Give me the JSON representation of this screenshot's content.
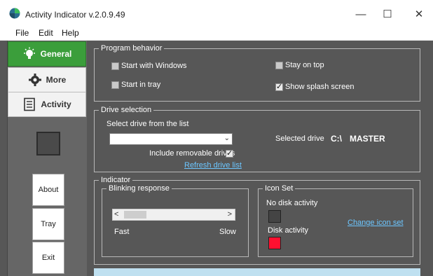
{
  "window": {
    "title": "Activity Indicator v.2.0.9.49",
    "controls": {
      "minimize": "—",
      "maximize": "☐",
      "close": "✕"
    }
  },
  "menu": [
    "File",
    "Edit",
    "Help"
  ],
  "sidebar": {
    "nav": [
      {
        "label": "General",
        "icon": "lightbulb-icon",
        "active": true
      },
      {
        "label": "More",
        "icon": "gear-icon",
        "active": false
      },
      {
        "label": "Activity",
        "icon": "document-icon",
        "active": false
      }
    ],
    "buttons": [
      "About",
      "Tray",
      "Exit"
    ]
  },
  "program_behavior": {
    "legend": "Program behavior",
    "start_with_windows": {
      "label": "Start with Windows",
      "checked": false
    },
    "start_in_tray": {
      "label": "Start in tray",
      "checked": false
    },
    "stay_on_top": {
      "label": "Stay on top",
      "checked": false
    },
    "show_splash": {
      "label": "Show splash screen",
      "checked": true
    }
  },
  "drive_selection": {
    "legend": "Drive selection",
    "select_label": "Select drive from the list",
    "dropdown_value": "",
    "include_removable": {
      "label": "Include removable drives",
      "checked": true
    },
    "refresh_link": "Refresh drive list",
    "selected_label": "Selected drive",
    "selected_drive": "C:\\",
    "selected_name": "MASTER"
  },
  "indicator": {
    "legend": "Indicator",
    "blinking": {
      "legend": "Blinking response",
      "fast_label": "Fast",
      "slow_label": "Slow",
      "left_arrow": "<",
      "right_arrow": ">"
    },
    "icon_set": {
      "legend": "Icon Set",
      "no_activity_label": "No disk activity",
      "disk_activity_label": "Disk activity",
      "change_link": "Change icon set",
      "no_activity_color": "#444444",
      "activity_color": "#ff1030"
    }
  },
  "colors": {
    "accent_green": "#3b9e3b",
    "background": "#575757",
    "link": "#6cc6ff"
  }
}
